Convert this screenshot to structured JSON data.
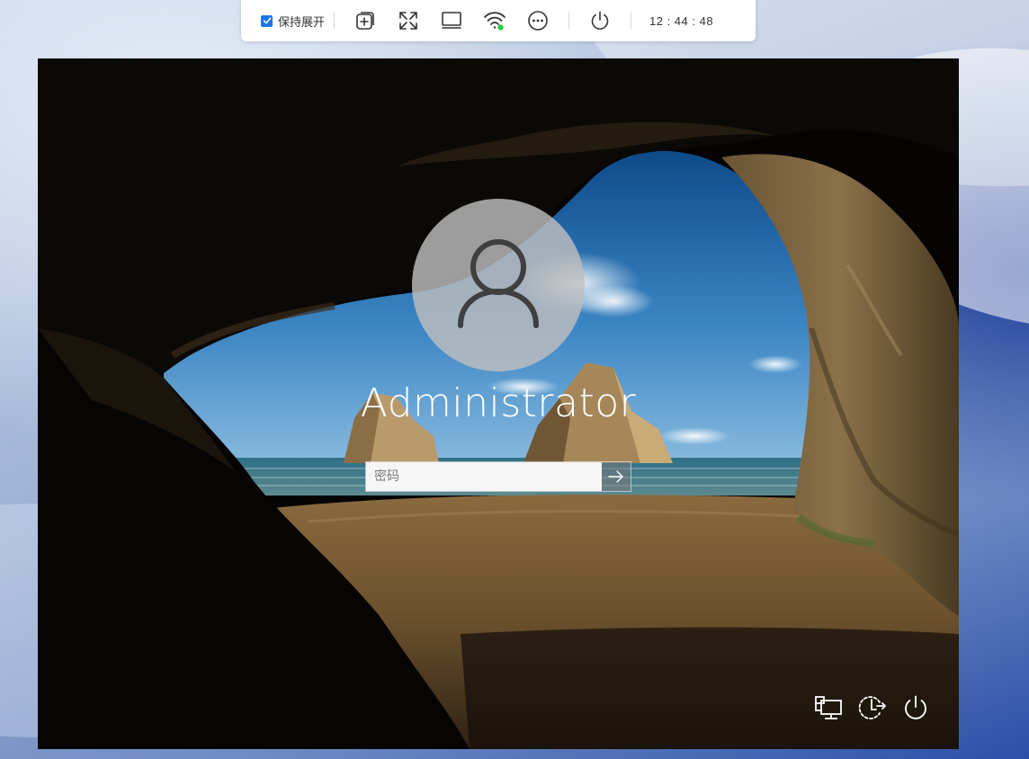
{
  "toolbar": {
    "keep_expanded_label": "保持展开",
    "keep_expanded_checked": true,
    "icons": [
      "add-window-icon",
      "fullscreen-icon",
      "monitor-icon",
      "wifi-signal-icon",
      "more-options-icon",
      "power-icon"
    ],
    "clock": "12 : 44 : 48",
    "accent_color": "#1f74e8",
    "signal_status_color": "#2ecc40"
  },
  "login": {
    "username": "Administrator",
    "password_placeholder": "密码",
    "corner_icons": [
      "network-icon",
      "ease-of-access-icon",
      "shutdown-icon"
    ]
  }
}
